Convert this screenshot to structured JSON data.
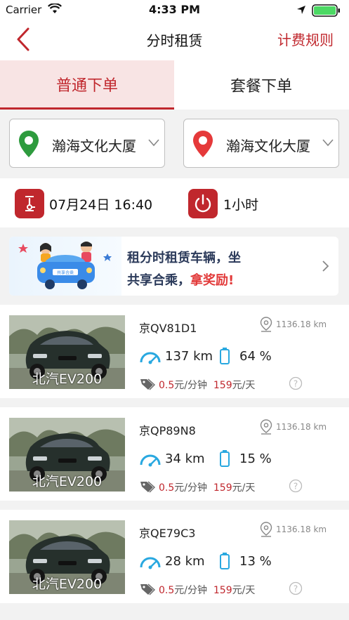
{
  "status_bar": {
    "carrier": "Carrier",
    "time": "4:33 PM"
  },
  "nav": {
    "title": "分时租赁",
    "right_action": "计费规则"
  },
  "tabs": [
    {
      "label": "普通下单",
      "active": true
    },
    {
      "label": "套餐下单",
      "active": false
    }
  ],
  "locations": {
    "start": {
      "label": "瀚海文化大厦",
      "pin_color": "#2e9b3e"
    },
    "end": {
      "label": "瀚海文化大厦",
      "pin_color": "#e5393a"
    }
  },
  "schedule": {
    "datetime": "07月24日 16:40",
    "duration": "1小时"
  },
  "banner": {
    "line1": "租分时租赁车辆，坐",
    "line2_prefix": "共享合乘，",
    "line2_highlight": "拿奖励!",
    "car_label": "共享合乘"
  },
  "cars": [
    {
      "plate": "京QV81D1",
      "distance": "1136.18 km",
      "range": "137 km",
      "battery": "64 %",
      "price_per_min": "0.5",
      "unit_min": "元/分钟",
      "price_per_day": "159",
      "unit_day": "元/天",
      "model": "北汽EV200"
    },
    {
      "plate": "京QP89N8",
      "distance": "1136.18 km",
      "range": "34 km",
      "battery": "15 %",
      "price_per_min": "0.5",
      "unit_min": "元/分钟",
      "price_per_day": "159",
      "unit_day": "元/天",
      "model": "北汽EV200"
    },
    {
      "plate": "京QE79C3",
      "distance": "1136.18 km",
      "range": "28 km",
      "battery": "13 %",
      "price_per_min": "0.5",
      "unit_min": "元/分钟",
      "price_per_day": "159",
      "unit_day": "元/天",
      "model": "北汽EV200"
    }
  ],
  "colors": {
    "accent": "#c0272d",
    "gauge": "#29a8e0"
  },
  "icons": [
    "wifi-icon",
    "location-arrow-icon",
    "battery-icon",
    "back-chevron-icon",
    "map-pin-icon",
    "chevron-down-icon",
    "clock-icon",
    "power-icon",
    "chevron-right-icon",
    "location-outline-icon",
    "gauge-icon",
    "battery-level-icon",
    "price-tag-icon",
    "help-icon"
  ]
}
